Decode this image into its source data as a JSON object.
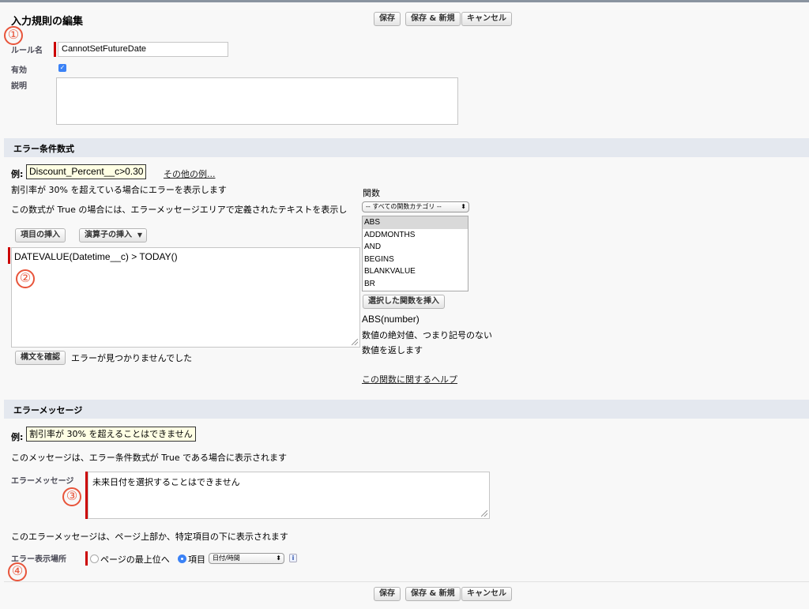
{
  "header": {
    "title": "入力規則の編集",
    "buttons": {
      "save": "保存",
      "save_new": "保存 & 新規",
      "cancel": "キャンセル"
    }
  },
  "markers": [
    "①",
    "②",
    "③",
    "④"
  ],
  "rule": {
    "name_label": "ルール名",
    "name_value": "CannotSetFutureDate",
    "active_label": "有効",
    "active_checked": true,
    "description_label": "説明",
    "description_value": ""
  },
  "formula_section": {
    "title": "エラー条件数式",
    "example_label": "例:",
    "example_value": "Discount_Percent__c>0.30",
    "more_examples": "その他の例...",
    "example_desc": "割引率が 30% を超えている場合にエラーを表示します",
    "instruction": "この数式が True の場合には、エラーメッセージエリアで定義されたテキストを表示し",
    "insert_field": "項目の挿入",
    "insert_operator": "演算子の挿入",
    "formula": "DATEVALUE(Datetime__c) >  TODAY()",
    "check_syntax": "構文を確認",
    "syntax_result": "エラーが見つかりませんでした",
    "functions": {
      "label": "関数",
      "category": "-- すべての関数カテゴリ --",
      "items": [
        "ABS",
        "ADDMONTHS",
        "AND",
        "BEGINS",
        "BLANKVALUE",
        "BR"
      ],
      "selected": "ABS",
      "insert_button": "選択した関数を挿入",
      "signature": "ABS(number)",
      "description": "数値の絶対値、つまり記号のない数値を返します",
      "help_link": "この関数に関するヘルプ"
    }
  },
  "message_section": {
    "title": "エラーメッセージ",
    "example_label": "例:",
    "example_value": "割引率が 30% を超えることはできません",
    "condition_desc": "このメッセージは、エラー条件数式が True である場合に表示されます",
    "message_label": "エラーメッセージ",
    "message_value": "未来日付を選択することはできません",
    "location_desc": "このエラーメッセージは、ページ上部か、特定項目の下に表示されます",
    "location_label": "エラー表示場所",
    "option_top": "ページの最上位へ",
    "option_field": "項目",
    "selected_option": "field",
    "field_value": "日付/時間"
  },
  "colors": {
    "required": "#cc0000",
    "section_bar": "#e4e8ef",
    "marker": "#e8543a"
  }
}
